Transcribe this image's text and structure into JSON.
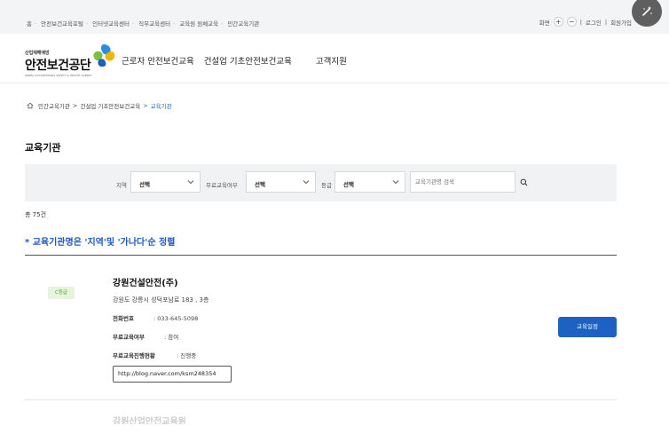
{
  "utilbar": {
    "links": [
      "홈",
      "안전보건교육포털",
      "인터넷교육센터",
      "직무교육센터",
      "교육원 원체교육",
      "민간교육기관"
    ],
    "right_label": "화면",
    "zoom_in": "+",
    "zoom_out": "−",
    "login": "로그인",
    "join": "회원가입"
  },
  "header": {
    "logo_sub": "산업재해예방",
    "logo_main": "안전보건공단",
    "logo_eng": "KOREA OCCUPATIONAL SAFETY & HEALTH AGENCY",
    "nav": [
      "근로자 안전보건교육",
      "건설업 기초안전보건교육",
      "고객지원"
    ]
  },
  "breadcrumb": [
    "민간교육기관",
    "건설업 기초안전보건교육",
    "교육기관"
  ],
  "page_title": "교육기관",
  "filters": {
    "region_label": "지역",
    "region_value": "선택",
    "free_label": "무료교육여부",
    "free_value": "선택",
    "grade_label": "등급",
    "grade_value": "선택",
    "keyword_placeholder": "교육기관명 검색"
  },
  "total": "총 75건",
  "notice": "* 교육기관명은 '지역'및 '가나다'순 정렬",
  "result": {
    "grade": "C등급",
    "name": "강원건설안전(주)",
    "address": "강원도 강릉시 성덕포남로 183 , 3층",
    "phone_label": "전화번호",
    "phone": ": 033-645-5098",
    "free_label": "무료교육여부",
    "free": ": 참여",
    "status_label": "무료교육진행현황",
    "status": ": 진행중",
    "url": "http://blog.naver.com/ksm248354",
    "schedule_button": "교육일정"
  },
  "next_peek": "강원산업안전교육원"
}
